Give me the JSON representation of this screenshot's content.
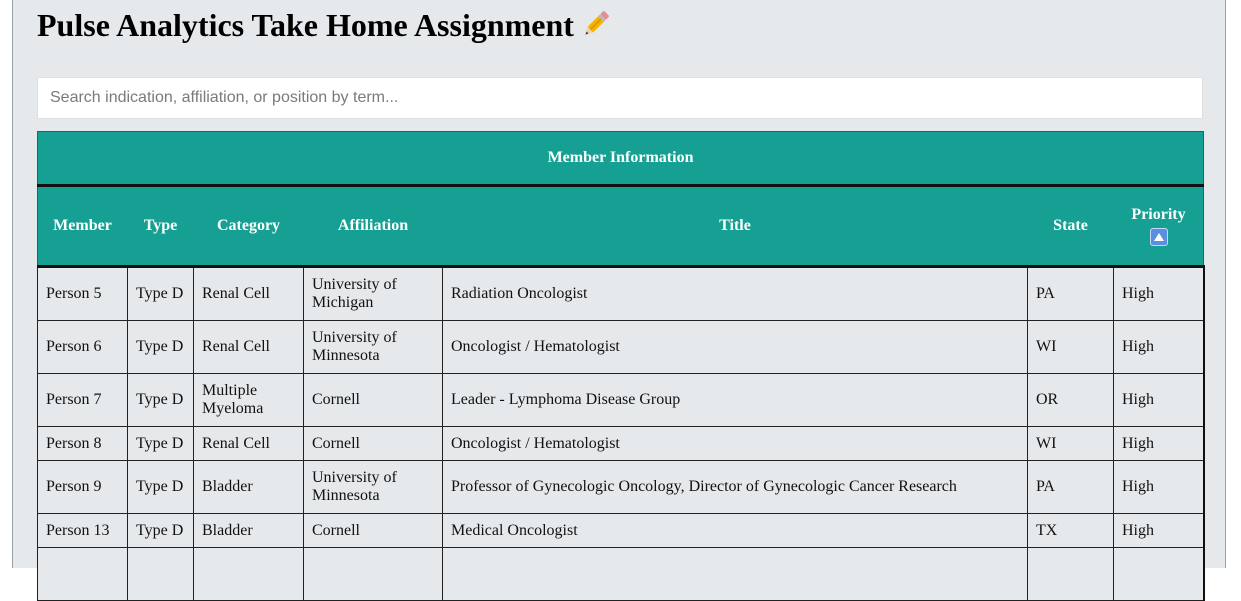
{
  "header": {
    "title": "Pulse Analytics Take Home Assignment",
    "title_icon": "pencil-icon"
  },
  "search": {
    "placeholder": "Search indication, affiliation, or position by term...",
    "value": ""
  },
  "table": {
    "group_header": "Member Information",
    "columns": [
      "Member",
      "Type",
      "Category",
      "Affiliation",
      "Title",
      "State",
      "Priority"
    ],
    "sort": {
      "column": "Priority",
      "icon": "sort-ascending-icon"
    },
    "rows": [
      [
        "Person 5",
        "Type D",
        "Renal Cell",
        "University of Michigan",
        "Radiation Oncologist",
        "PA",
        "High"
      ],
      [
        "Person 6",
        "Type D",
        "Renal Cell",
        "University of Minnesota",
        "Oncologist / Hematologist",
        "WI",
        "High"
      ],
      [
        "Person 7",
        "Type D",
        "Multiple Myeloma",
        "Cornell",
        "Leader - Lymphoma Disease Group",
        "OR",
        "High"
      ],
      [
        "Person 8",
        "Type D",
        "Renal Cell",
        "Cornell",
        "Oncologist / Hematologist",
        "WI",
        "High"
      ],
      [
        "Person 9",
        "Type D",
        "Bladder",
        "University of Minnesota",
        "Professor of Gynecologic Oncology, Director of Gynecologic Cancer Research",
        "PA",
        "High"
      ],
      [
        "Person 13",
        "Type D",
        "Bladder",
        "Cornell",
        "Medical Oncologist",
        "TX",
        "High"
      ],
      [
        "",
        "",
        "",
        "",
        "",
        "",
        ""
      ]
    ]
  },
  "colors": {
    "header_bg": "#16a093",
    "page_bg": "#e6e9eb"
  }
}
